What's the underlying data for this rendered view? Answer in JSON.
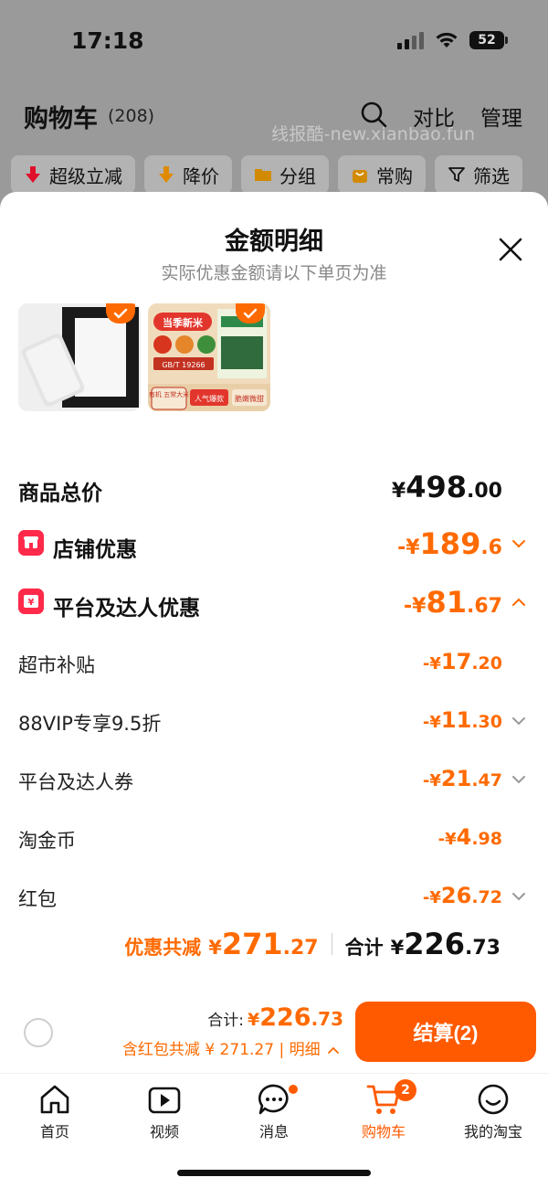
{
  "status_bar": {
    "time": "17:18",
    "battery": "52"
  },
  "header": {
    "title": "购物车",
    "count": "(208)",
    "watermark": "线报酷-new.xianbao.fun",
    "compare": "对比",
    "manage": "管理"
  },
  "filters": [
    {
      "label": "超级立减",
      "icon": "red-down-arrow-icon"
    },
    {
      "label": "降价",
      "icon": "orange-down-arrow-icon"
    },
    {
      "label": "分组",
      "icon": "folder-icon"
    },
    {
      "label": "常购",
      "icon": "bag-icon"
    },
    {
      "label": "筛选",
      "icon": "filter-icon"
    }
  ],
  "sheet": {
    "title": "金额明细",
    "subtitle": "实际优惠金额请以下单页为准"
  },
  "products": [
    {
      "name": "frame-product"
    },
    {
      "name": "rice-product",
      "texts": [
        "当季新米",
        "GB/T 19266",
        "有机 五常大米",
        "人气爆款",
        "脆嫩微甜"
      ]
    }
  ],
  "rows": {
    "total_price": {
      "label": "商品总价",
      "yen": "¥",
      "int": "498",
      "dec": ".00"
    },
    "store_discount": {
      "label": "店铺优惠",
      "yen": "-¥",
      "int": "189",
      "dec": ".6"
    },
    "platform_discount": {
      "label": "平台及达人优惠",
      "yen": "-¥",
      "int": "81",
      "dec": ".67"
    },
    "sub": [
      {
        "label": "超市补贴",
        "yen": "-¥",
        "int": "17",
        "dec": ".20",
        "chevron": false
      },
      {
        "label": "88VIP专享9.5折",
        "yen": "-¥",
        "int": "11",
        "dec": ".30",
        "chevron": true
      },
      {
        "label": "平台及达人券",
        "yen": "-¥",
        "int": "21",
        "dec": ".47",
        "chevron": true
      },
      {
        "label": "淘金币",
        "yen": "-¥",
        "int": "4",
        "dec": ".98",
        "chevron": false
      },
      {
        "label": "红包",
        "yen": "-¥",
        "int": "26",
        "dec": ".72",
        "chevron": true
      }
    ]
  },
  "summary": {
    "discount_label": "优惠共减",
    "discount_yen": "¥",
    "discount_int": "271",
    "discount_dec": ".27",
    "total_label": "合计",
    "total_yen": "¥",
    "total_int": "226",
    "total_dec": ".73"
  },
  "checkout": {
    "total_label": "合计:",
    "total_yen": "¥",
    "total_int": "226",
    "total_dec": ".73",
    "detail": "含红包共减 ¥ 271.27 | 明细",
    "button": "结算(2)"
  },
  "tabs": [
    {
      "label": "首页",
      "icon": "home-icon"
    },
    {
      "label": "视频",
      "icon": "video-icon"
    },
    {
      "label": "消息",
      "icon": "message-icon"
    },
    {
      "label": "购物车",
      "icon": "cart-icon",
      "badge": "2",
      "active": true
    },
    {
      "label": "我的淘宝",
      "icon": "profile-icon"
    }
  ],
  "colors": {
    "accent": "#ff5a00",
    "discount": "#ff6a00",
    "badge_red": "#ff2a4a"
  }
}
